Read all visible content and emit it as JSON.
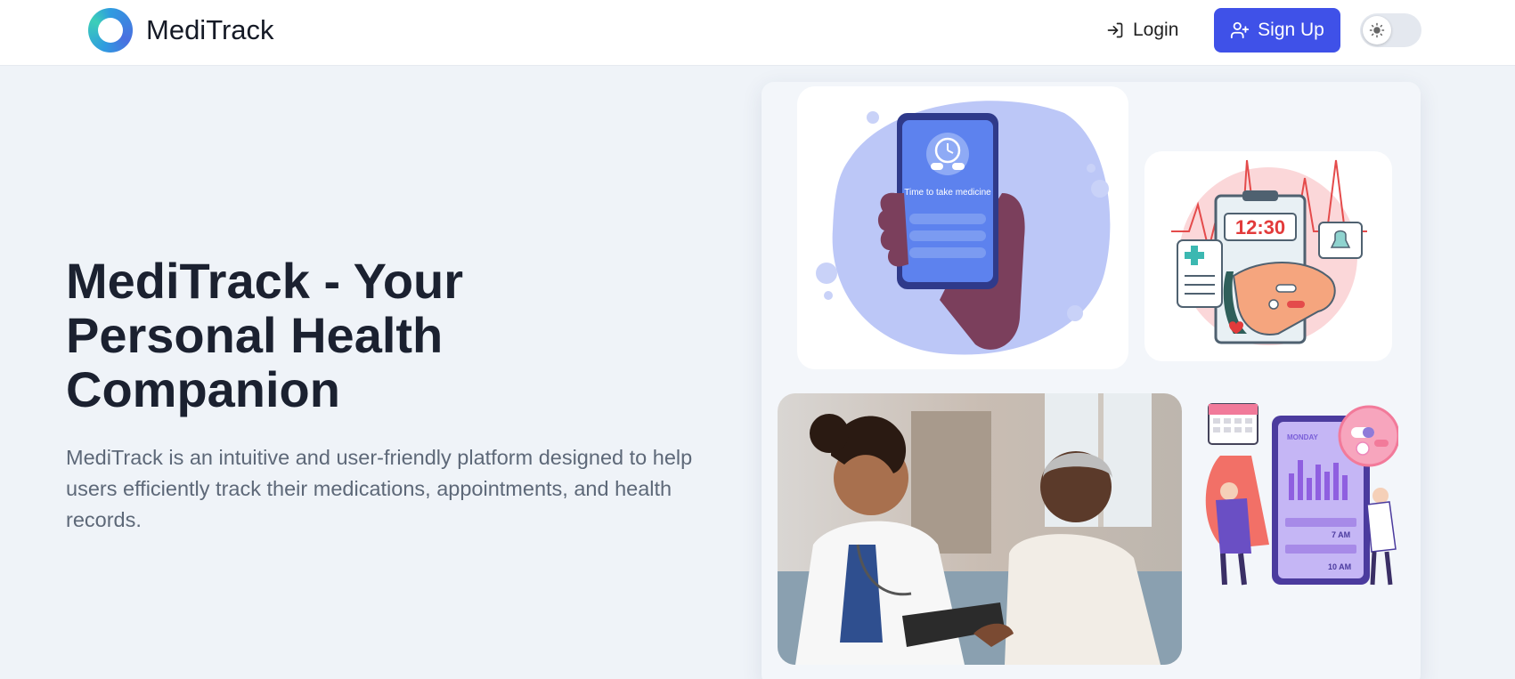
{
  "nav": {
    "brand": "MediTrack",
    "login_label": "Login",
    "signup_label": "Sign Up"
  },
  "hero": {
    "title": "MediTrack - Your Personal Health Companion",
    "description": "MediTrack is an intuitive and user-friendly platform designed to help users efficiently track their medications, appointments, and health records."
  },
  "illustrations": {
    "phone_text": "Time to take medicine",
    "clock_time": "12:30",
    "schedule_day": "MONDAY",
    "schedule_time_1": "7 AM",
    "schedule_time_2": "10 AM"
  },
  "colors": {
    "accent": "#3f51e8",
    "background": "#eff3f8",
    "title": "#1b2130",
    "body_text": "#5d6878"
  },
  "icons": {
    "login": "login-arrow-icon",
    "signup": "user-plus-icon",
    "theme": "sun-icon"
  }
}
